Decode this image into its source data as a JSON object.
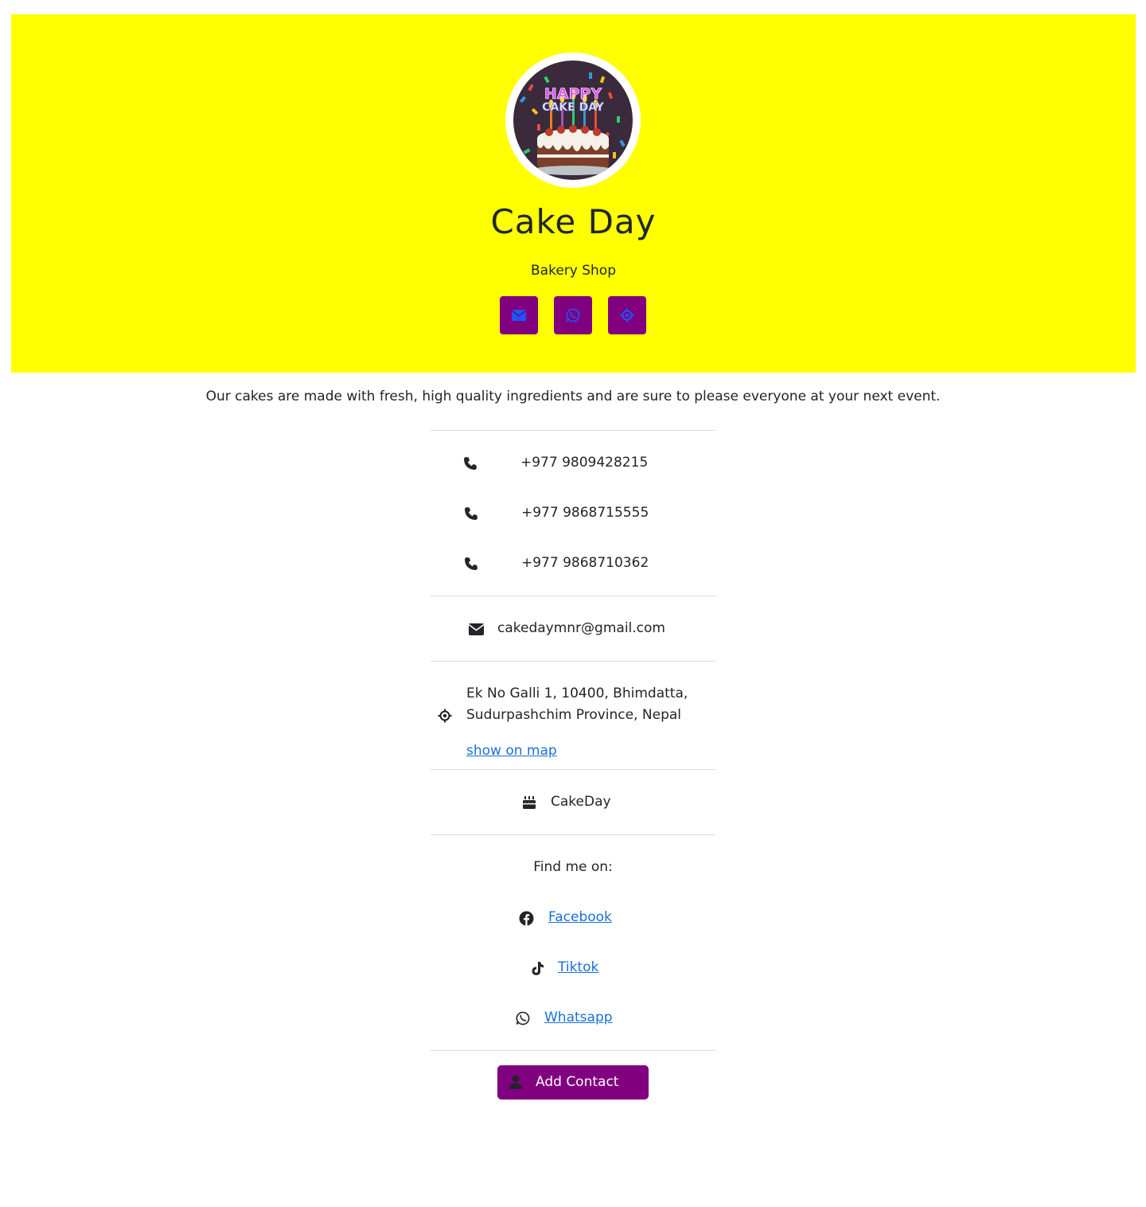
{
  "colors": {
    "hero_bg": "#ffff00",
    "accent": "#800080",
    "icon_blue": "#1a56ff",
    "link": "#1a6fd8"
  },
  "profile": {
    "name": "Cake Day",
    "tagline": "Bakery Shop",
    "avatar_text_line1": "HAPPY",
    "avatar_text_line2": "CAKE DAY"
  },
  "quick_actions": [
    {
      "icon": "envelope-icon"
    },
    {
      "icon": "whatsapp-icon"
    },
    {
      "icon": "location-icon"
    }
  ],
  "intro": "Our cakes are made with fresh, high quality ingredients and are sure to please everyone at your next event.",
  "phones": [
    "+977 9809428215",
    "+977 9868715555",
    "+977 9868710362"
  ],
  "email": "cakedaymnr@gmail.com",
  "address": {
    "line1": "Ek No Galli 1, 10400, Bhimdatta,",
    "line2": "Sudurpashchim Province, Nepal",
    "map_link": "show on map"
  },
  "company": "CakeDay",
  "social": {
    "heading": "Find me on:",
    "links": [
      "Facebook",
      "Tiktok",
      "Whatsapp"
    ]
  },
  "add_contact_label": "Add Contact"
}
